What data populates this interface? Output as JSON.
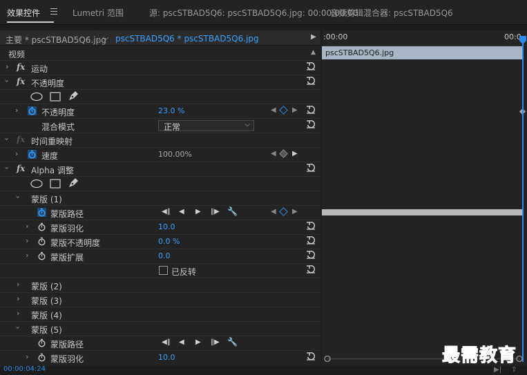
{
  "tabs": {
    "effect_controls": "效果控件",
    "lumetri": "Lumetri 范围",
    "source": "源: pscSTBAD5Q6: pscSTBAD5Q6.jpg: 00:00:00:00",
    "audio_mixer": "音频剪辑混合器: pscSTBAD5Q6"
  },
  "subhead": {
    "master": "主要 * pscSTBAD5Q6.jpg",
    "clip": "pscSTBAD5Q6 * pscSTBAD5Q6.jpg"
  },
  "timeline": {
    "ruler_start": ":00:00",
    "ruler_end": "00:0",
    "clip_name": "pscSTBAD5Q6.jpg"
  },
  "rows": {
    "video": "视频",
    "motion": "运动",
    "opacity": "不透明度",
    "opacity_param": "不透明度",
    "opacity_value": "23.0 %",
    "blend_mode": "混合模式",
    "blend_value": "正常",
    "time_remap": "时间重映射",
    "speed": "速度",
    "speed_value": "100.00%",
    "alpha_adjust": "Alpha 调整",
    "mask1": "蒙版 (1)",
    "mask_path": "蒙版路径",
    "mask_feather": "蒙版羽化",
    "mask_feather_value": "10.0",
    "mask_opacity": "蒙版不透明度",
    "mask_opacity_value": "0.0 %",
    "mask_expansion": "蒙版扩展",
    "mask_expansion_value": "0.0",
    "inverted": "已反转",
    "mask2": "蒙版 (2)",
    "mask3": "蒙版 (3)",
    "mask4": "蒙版 (4)",
    "mask5": "蒙版 (5)",
    "mask5_path": "蒙版路径",
    "mask5_feather": "蒙版羽化",
    "mask5_feather_value": "10.0"
  },
  "timecode": "00:00:04:24",
  "watermark": "最需教育",
  "colors": {
    "accent": "#2d8ceb",
    "value_blue": "#3aa1ff",
    "clip_bar": "#a8b5c4",
    "panel_bg": "#232323"
  }
}
